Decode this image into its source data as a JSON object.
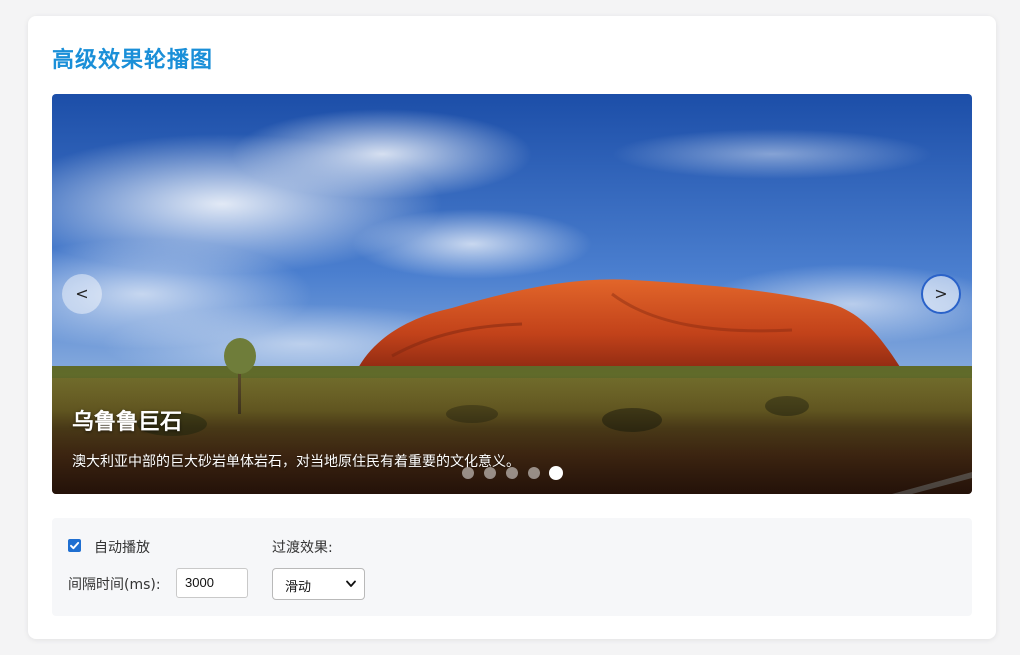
{
  "page": {
    "title": "高级效果轮播图"
  },
  "carousel": {
    "prev_label": "<",
    "next_label": ">",
    "slide": {
      "title": "乌鲁鲁巨石",
      "description": "澳大利亚中部的巨大砂岩单体岩石，对当地原住民有着重要的文化意义。"
    },
    "slide_count": 5,
    "active_index": 5
  },
  "controls": {
    "autoplay_label": "自动播放",
    "autoplay_checked": true,
    "transition_label": "过渡效果:",
    "interval_label": "间隔时间(ms):",
    "interval_value": "3000",
    "transition_value": "滑动"
  },
  "colors": {
    "title": "#1a8fd8",
    "accent": "#1f6fd1"
  },
  "icons": {
    "checkbox": "checkmark-icon",
    "select": "chevron-down-icon"
  }
}
